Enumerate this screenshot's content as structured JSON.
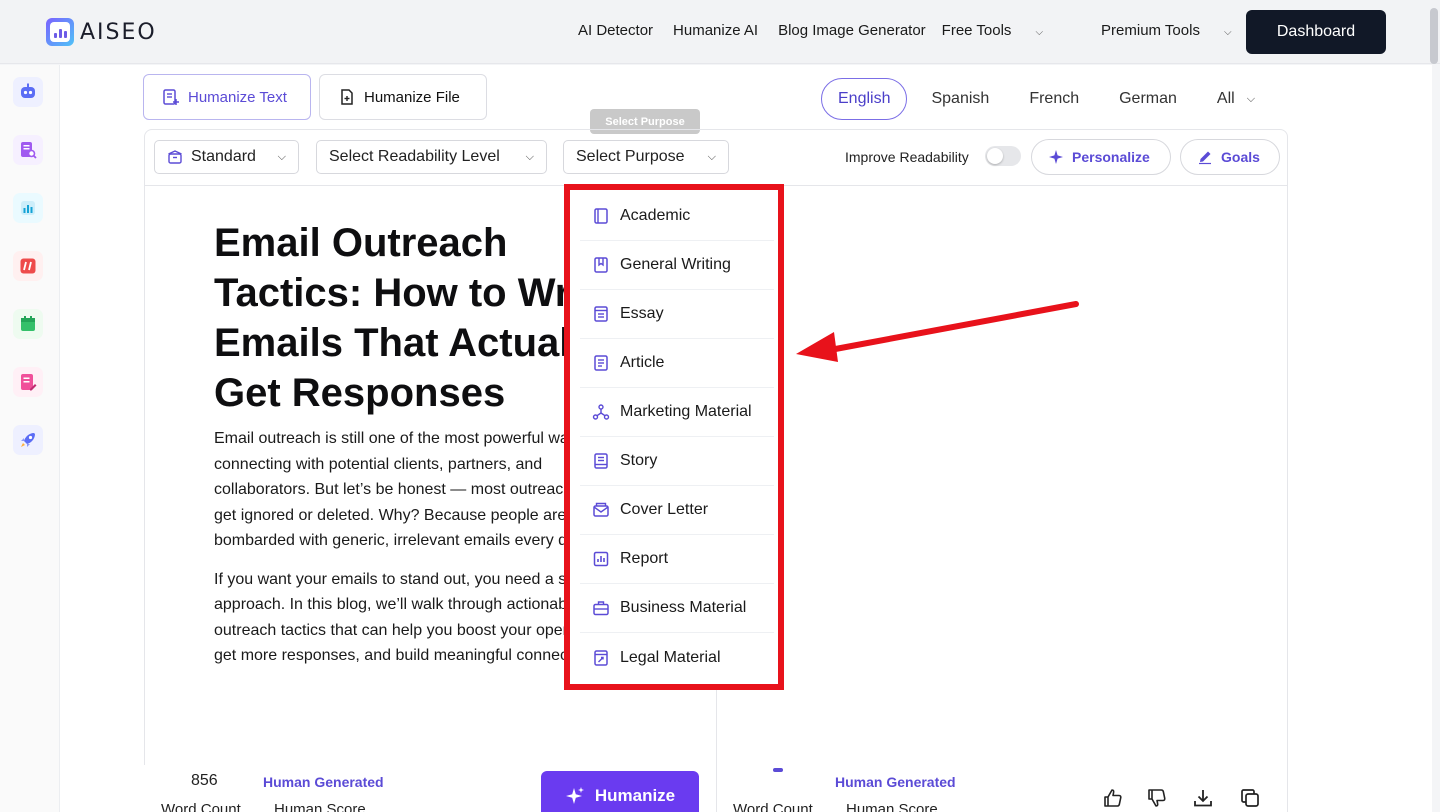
{
  "brand": {
    "name": "AISEO"
  },
  "nav": {
    "links": [
      "AI Detector",
      "Humanize AI",
      "Blog Image Generator",
      "Free Tools",
      "Premium Tools"
    ],
    "dashboard_label": "Dashboard"
  },
  "tabs": {
    "text": "Humanize Text",
    "file": "Humanize File"
  },
  "languages": [
    "English",
    "Spanish",
    "French",
    "German",
    "All"
  ],
  "toolbar": {
    "mode": "Standard",
    "readability": "Select Readability Level",
    "purpose": "Select Purpose",
    "improve_readability": "Improve Readability",
    "personalize": "Personalize",
    "goals": "Goals",
    "tooltip": "Select Purpose"
  },
  "purpose_options": [
    {
      "label": "Academic",
      "icon": "book-icon"
    },
    {
      "label": "General Writing",
      "icon": "bookmark-icon"
    },
    {
      "label": "Essay",
      "icon": "essay-icon"
    },
    {
      "label": "Article",
      "icon": "document-icon"
    },
    {
      "label": "Marketing Material",
      "icon": "network-icon"
    },
    {
      "label": "Story",
      "icon": "story-icon"
    },
    {
      "label": "Cover Letter",
      "icon": "envelope-icon"
    },
    {
      "label": "Report",
      "icon": "chart-report-icon"
    },
    {
      "label": "Business Material",
      "icon": "briefcase-icon"
    },
    {
      "label": "Legal Material",
      "icon": "legal-doc-icon"
    }
  ],
  "article": {
    "title": "Email Outreach Tactics: How to Write Emails That Actually Get Responses",
    "para1": "Email outreach is still one of the most powerful ways for connecting with potential clients, partners, and collaborators. But let’s be honest — most outreach emails get ignored or deleted. Why? Because people are bombarded with generic, irrelevant emails every day.",
    "para2": "If you want your emails to stand out, you need a smarter approach. In this blog, we’ll walk through actionable email outreach tactics that can help you boost your open rates, get more responses, and build meaningful connections."
  },
  "stats_left": {
    "word_count": "856",
    "human_label": "Human Generated",
    "word_count_caption": "Word Count",
    "human_score_caption": "Human Score"
  },
  "stats_right": {
    "human_label": "Human Generated",
    "word_count_caption": "Word Count",
    "human_score_caption": "Human Score"
  },
  "humanize_label": "Humanize",
  "colors": {
    "accent": "#5b4bd6",
    "highlight": "#e8121b",
    "button": "#6a3bf0",
    "dark": "#111827"
  }
}
